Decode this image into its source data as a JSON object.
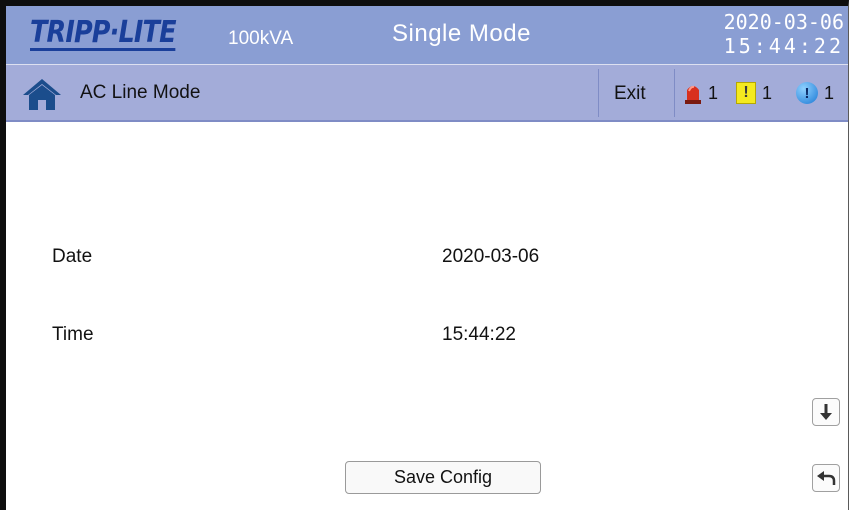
{
  "header": {
    "logo": "TRIPP·LITE",
    "capacity": "100kVA",
    "mode": "Single Mode",
    "date": "2020-03-06",
    "time": "15:44:22"
  },
  "subheader": {
    "title": "AC Line Mode",
    "exit_label": "Exit",
    "alarms": {
      "critical_count": "1",
      "warning_count": "1",
      "info_count": "1",
      "warning_symbol": "!",
      "info_symbol": "!"
    }
  },
  "settings": {
    "date_label": "Date",
    "date_value": "2020-03-06",
    "time_label": "Time",
    "time_value": "15:44:22"
  },
  "actions": {
    "save_label": "Save Config"
  },
  "icons": {
    "home": "home-icon",
    "critical": "alarm-siren-icon",
    "warning": "warning-icon",
    "info": "info-icon",
    "scroll_down": "arrow-down-icon",
    "back": "back-arrow-icon"
  },
  "colors": {
    "header_bg": "#8a9ed3",
    "subheader_bg": "#a3acd9",
    "logo_blue": "#1a3f9a"
  }
}
